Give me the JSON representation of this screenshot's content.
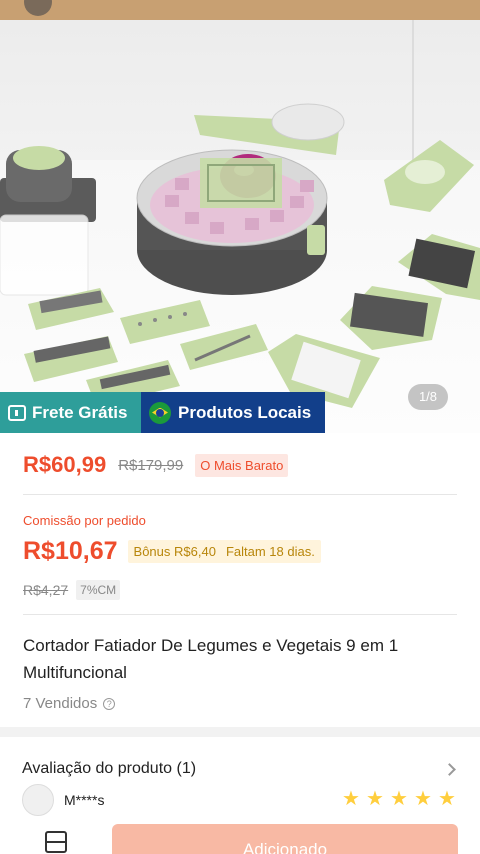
{
  "hero": {
    "counter": "1/8",
    "badges": {
      "free_shipping": "Frete Grátis",
      "local_products": "Produtos Locais"
    }
  },
  "price": {
    "current": "R$60,99",
    "original": "R$179,99",
    "tag": "O Mais Barato"
  },
  "commission": {
    "label": "Comissão por pedido",
    "amount": "R$10,67",
    "bonus": "Bônus R$6,40",
    "remaining": "Faltam 18 dias.",
    "old_amount": "R$4,27",
    "cm_tag": "7%CM"
  },
  "product": {
    "title": "Cortador Fatiador De Legumes e Vegetais 9 em 1 Multifuncional",
    "sold": "7 Vendidos"
  },
  "review": {
    "title": "Avaliação do produto (1)",
    "reviewer": "M****s",
    "stars": 5
  },
  "bottom": {
    "add_button": "Adicionado"
  },
  "colors": {
    "accent": "#ee4d2d",
    "free_badge": "#2e9e9a",
    "local_badge": "#123f8a",
    "star": "#ffce3d"
  }
}
